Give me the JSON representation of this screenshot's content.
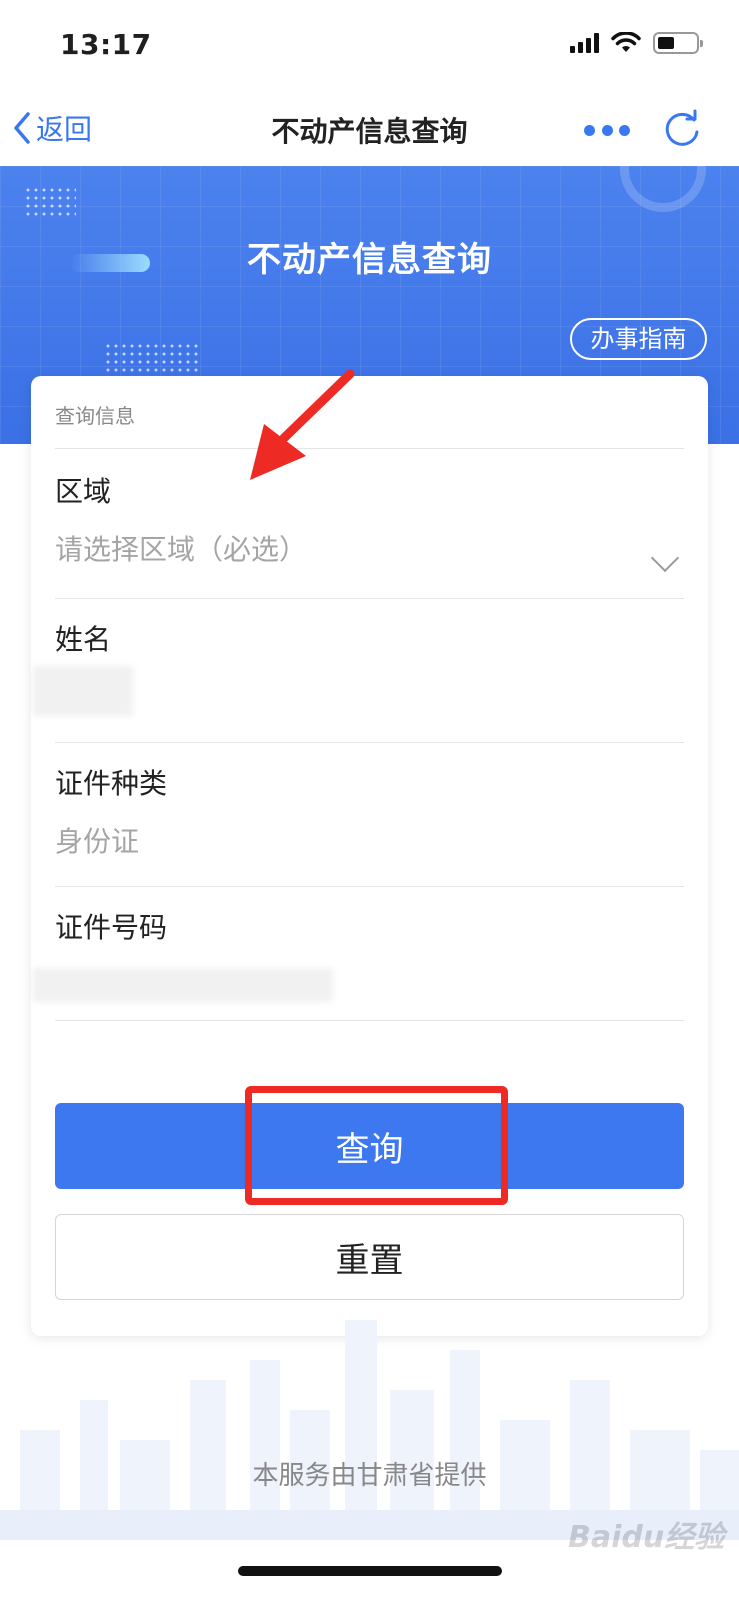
{
  "status_bar": {
    "time": "13:17"
  },
  "nav": {
    "back_label": "返回",
    "title": "不动产信息查询"
  },
  "banner": {
    "title": "不动产信息查询",
    "guide_label": "办事指南"
  },
  "form": {
    "section_title": "查询信息",
    "fields": [
      {
        "label": "区域",
        "value": "请选择区域（必选）"
      },
      {
        "label": "姓名",
        "value": ""
      },
      {
        "label": "证件种类",
        "value": "身份证"
      },
      {
        "label": "证件号码",
        "value": ""
      }
    ],
    "query_label": "查询",
    "reset_label": "重置"
  },
  "footer": {
    "text": "本服务由甘肃省提供",
    "watermark": "Baidu经验"
  },
  "colors": {
    "accent": "#3d78f1",
    "banner": "#4c82ee",
    "annotation_red": "#ee2a24"
  }
}
